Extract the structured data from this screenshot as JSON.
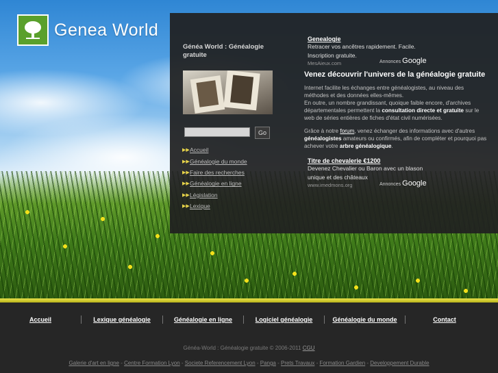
{
  "logo": {
    "text": "Genea World",
    "icon": "tree-icon"
  },
  "site": {
    "title": "Généa World : Généalogie gratuite"
  },
  "search": {
    "placeholder": "",
    "button": "Go"
  },
  "side_nav": [
    {
      "label": "Accueil"
    },
    {
      "label": "Généalogie du monde"
    },
    {
      "label": "Faire des recherches"
    },
    {
      "label": "Généalogie en ligne"
    },
    {
      "label": "Législation"
    },
    {
      "label": "Lexique"
    }
  ],
  "ad_top": {
    "title": "Genealogie",
    "lines": [
      "Retracer vos ancêtres rapidement. Facile.",
      "Inscription gratuite."
    ],
    "url": "MesAieux.com",
    "annonces": "Annonces",
    "google": "Google"
  },
  "main": {
    "headline": "Venez découvrir l'univers de la généalogie gratuite",
    "p1_a": "Internet facilite les échanges entre généalogistes, au niveau des méthodes et des données elles-mêmes.",
    "p1_b": "En outre, un nombre grandissant, quoique faible encore, d'archives départementales permettent la ",
    "p1_bold": "consultation directe et gratuite",
    "p1_c": " sur le web de séries entières de fiches d'état civil numérisées.",
    "p2_a": "Grâce à notre ",
    "p2_link": "forum",
    "p2_b": ", venez échanger des informations avec d'autres ",
    "p2_bold1": "généalogistes",
    "p2_c": " amateurs ou confirmés, afin de compléter et pourquoi pas achever votre ",
    "p2_bold2": "arbre généalogique",
    "p2_d": "."
  },
  "ad_bottom": {
    "title": "Titre de chevalerie €1200",
    "lines": [
      "Devenez Chevalier ou Baron avec un blason",
      "unique et des châteaux"
    ],
    "url": "www.imedmons.org",
    "annonces": "Annonces",
    "google": "Google"
  },
  "footer_nav": [
    {
      "label": "Accueil"
    },
    {
      "label": "Lexique généalogie"
    },
    {
      "label": "Généalogie en ligne"
    },
    {
      "label": "Logiciel généalogie"
    },
    {
      "label": "Généalogie du monde"
    },
    {
      "label": "Contact"
    }
  ],
  "copyright": {
    "text": "Généa-World : Généalogie gratuite © 2006-2011 ",
    "cgu": "CGU"
  },
  "partners": [
    "Galerie d'art en ligne",
    "Centre Formation Lyon",
    "Societe Referencement Lyon",
    "Panga",
    "Prets Travaux",
    "Formation Gardien",
    "Developpement Durable"
  ],
  "colors": {
    "panel": "#202020",
    "bullet": "#e8d44a",
    "logo_green": "#5aa02c"
  }
}
